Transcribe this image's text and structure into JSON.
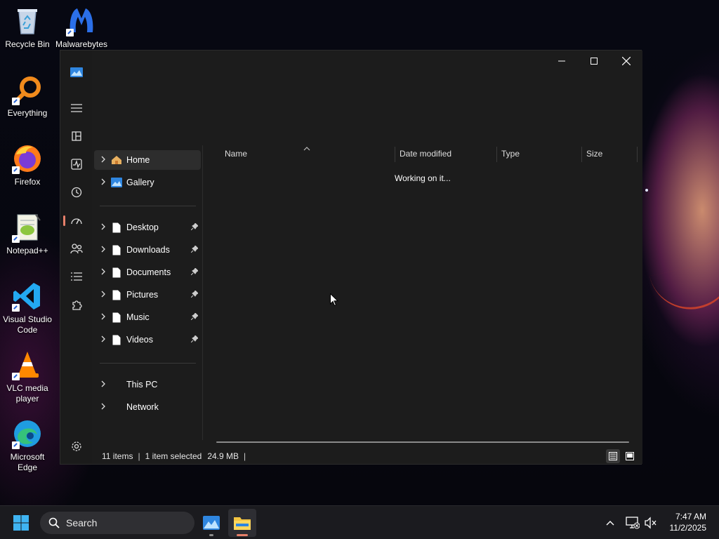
{
  "desktop": {
    "icons": [
      {
        "label": "Recycle Bin"
      },
      {
        "label": "Malwarebytes"
      },
      {
        "label": "Everything"
      },
      {
        "label": "Firefox"
      },
      {
        "label": "Notepad++"
      },
      {
        "label": "Visual Studio Code"
      },
      {
        "label": "VLC media player"
      },
      {
        "label": "Microsoft Edge"
      }
    ]
  },
  "window": {
    "caption": {
      "minimize_icon": "minimize-icon",
      "maximize_icon": "maximize-icon",
      "close_icon": "close-icon"
    },
    "rail_icons": [
      "app-logo-icon",
      "menu-icon",
      "layout-icon",
      "activity-icon",
      "history-icon",
      "speed-icon",
      "users-icon",
      "list-icon",
      "puzzle-icon",
      "settings-icon"
    ],
    "nav": {
      "home": "Home",
      "gallery": "Gallery",
      "pinned": [
        {
          "label": "Desktop"
        },
        {
          "label": "Downloads"
        },
        {
          "label": "Documents"
        },
        {
          "label": "Pictures"
        },
        {
          "label": "Music"
        },
        {
          "label": "Videos"
        }
      ],
      "this_pc": "This PC",
      "network": "Network"
    },
    "columns": {
      "name": "Name",
      "date_modified": "Date modified",
      "type": "Type",
      "size": "Size"
    },
    "content_message": "Working on it...",
    "status": {
      "items": "11 items",
      "selected": "1 item selected",
      "size": "24.9 MB"
    }
  },
  "taskbar": {
    "search_placeholder": "Search",
    "time": "7:47 AM",
    "date": "11/2/2025"
  },
  "colors": {
    "accent": "#e6806a",
    "folder": "#f4c542",
    "window_bg": "#1c1c1c"
  }
}
